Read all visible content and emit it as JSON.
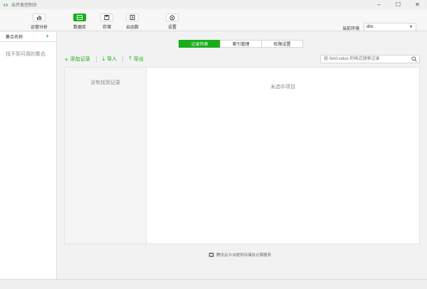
{
  "window": {
    "title": "云开发控制台",
    "minimize": "–",
    "maximize": "☐",
    "close": "✕"
  },
  "toolbar": {
    "items": [
      {
        "label": "运营分析",
        "icon": "bar-chart-icon"
      },
      {
        "label": "数据库",
        "icon": "database-icon"
      },
      {
        "label": "存储",
        "icon": "storage-icon"
      },
      {
        "label": "云函数",
        "icon": "cloud-function-icon"
      },
      {
        "label": "设置",
        "icon": "gear-icon"
      }
    ],
    "active_item": "数据库",
    "env_label": "当前环境",
    "env_value": "dbx"
  },
  "sidebar": {
    "header": "集合名称",
    "add_symbol": "+",
    "empty_text": "找不到可用的集合"
  },
  "main": {
    "tabs": [
      {
        "label": "记录列表",
        "active": true
      },
      {
        "label": "索引管理",
        "active": false
      },
      {
        "label": "权限设置",
        "active": false
      }
    ],
    "actions": {
      "add": "添加记录",
      "import": "导入",
      "export": "导出"
    },
    "search_placeholder": "按 field:value 的格式搜索记录",
    "list_empty": "没有找到记录",
    "detail_empty": "未选中项目",
    "footer_note": "腾讯云TCB提供存储及计算服务"
  },
  "colors": {
    "accent": "#1aad19",
    "background": "#f2f2f2"
  }
}
